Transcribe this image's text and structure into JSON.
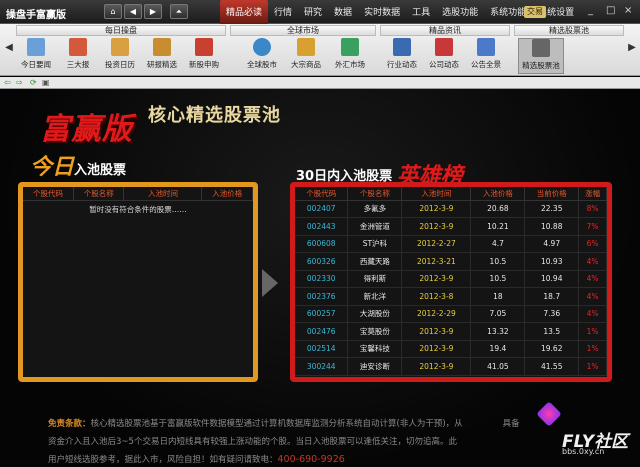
{
  "window": {
    "title": "操盘手富赢版",
    "nav": {
      "home": "⌂",
      "back": "◀",
      "forward": "▶",
      "up": "⏶"
    },
    "menu": [
      "精品必读",
      "行情",
      "研究",
      "数据",
      "实时数据",
      "工具",
      "选股功能",
      "系统功能",
      "系统设置"
    ],
    "menu_active_index": 0,
    "trade_label": "交易",
    "controls": {
      "min": "_",
      "max": "□",
      "close": "×"
    }
  },
  "toolbar": {
    "groups": [
      {
        "label": "每日操盘"
      },
      {
        "label": "全球市场"
      },
      {
        "label": "精品资讯"
      },
      {
        "label": "精选股票池"
      }
    ],
    "tools": [
      {
        "label": "今日要闻",
        "icon": "newspaper-icon",
        "color": "#6aa0d8"
      },
      {
        "label": "三大报",
        "icon": "reports-icon",
        "color": "#d25a3a"
      },
      {
        "label": "投资日历",
        "icon": "calendar-icon",
        "color": "#d8a040"
      },
      {
        "label": "研报精选",
        "icon": "document-icon",
        "color": "#c88d30"
      },
      {
        "label": "新股申购",
        "icon": "ipo-icon",
        "color": "#c84030"
      },
      {
        "label": "全球股市",
        "icon": "globe-icon",
        "color": "#3a88c8"
      },
      {
        "label": "大宗商品",
        "icon": "commodity-icon",
        "color": "#d8a030"
      },
      {
        "label": "外汇市场",
        "icon": "forex-icon",
        "color": "#3aa060"
      },
      {
        "label": "行业动态",
        "icon": "industry-chart-icon",
        "color": "#3a6ab0"
      },
      {
        "label": "公司动态",
        "icon": "company-icon",
        "color": "#c83838"
      },
      {
        "label": "公告全景",
        "icon": "announcement-icon",
        "color": "#4a7ac8"
      },
      {
        "label": "精选股票池",
        "icon": "stock-pool-icon",
        "color": "#666666"
      }
    ],
    "active_tool_index": 11
  },
  "banner": {
    "brand": "富赢版",
    "subtitle": "核心精选股票池"
  },
  "left_section": {
    "title_big": "今日",
    "title_rest": "入池股票",
    "columns": [
      "个股代码",
      "个股名称",
      "入池时间",
      "入池价格"
    ],
    "empty_message": "暂时没有符合条件的股票……"
  },
  "right_section": {
    "title": "30日内入池股票",
    "title_hero": "英雄榜",
    "columns": [
      "个股代码",
      "个股名称",
      "入池时间",
      "入池价格",
      "当前价格",
      "涨幅"
    ],
    "rows": [
      {
        "code": "002407",
        "name": "多氟多",
        "date": "2012-3-9",
        "entry": "20.68",
        "current": "22.35",
        "change": "8%"
      },
      {
        "code": "002443",
        "name": "金洲管道",
        "date": "2012-3-9",
        "entry": "10.21",
        "current": "10.88",
        "change": "7%"
      },
      {
        "code": "600608",
        "name": "ST沪科",
        "date": "2012-2-27",
        "entry": "4.7",
        "current": "4.97",
        "change": "6%"
      },
      {
        "code": "600326",
        "name": "西藏天路",
        "date": "2012-3-21",
        "entry": "10.5",
        "current": "10.93",
        "change": "4%"
      },
      {
        "code": "002330",
        "name": "得利斯",
        "date": "2012-3-9",
        "entry": "10.5",
        "current": "10.94",
        "change": "4%"
      },
      {
        "code": "002376",
        "name": "新北洋",
        "date": "2012-3-8",
        "entry": "18",
        "current": "18.7",
        "change": "4%"
      },
      {
        "code": "600257",
        "name": "大湖股份",
        "date": "2012-2-29",
        "entry": "7.05",
        "current": "7.36",
        "change": "4%"
      },
      {
        "code": "002476",
        "name": "宝莫股份",
        "date": "2012-3-9",
        "entry": "13.32",
        "current": "13.5",
        "change": "1%"
      },
      {
        "code": "002514",
        "name": "宝馨科技",
        "date": "2012-3-9",
        "entry": "19.4",
        "current": "19.62",
        "change": "1%"
      },
      {
        "code": "300244",
        "name": "迪安诊断",
        "date": "2012-3-9",
        "entry": "41.05",
        "current": "41.55",
        "change": "1%"
      }
    ]
  },
  "disclaimer": {
    "lead": "免责条款：",
    "line1": "核心精选股票池基于富赢版软件数据模型通过计算机数据库监测分析系统自动计算(非人为干预)，从",
    "line1b": "具备",
    "line2": "资金介入且入池后3~5个交易日内短线具有较强上涨动能的个股。当日入池股票可以逢低关注，切勿追高。此",
    "line3": "用户短线选股参考，据此入市，风险自担！如有疑问请致电：",
    "phone": "400-690-9926"
  },
  "watermark": {
    "text": "FLY社区",
    "url": "bbs.0xy.cn"
  },
  "colors": {
    "accent_red": "#d11a1a",
    "accent_orange": "#e2981f",
    "code_blue": "#3ab8d8",
    "date_yellow": "#e8d040"
  }
}
